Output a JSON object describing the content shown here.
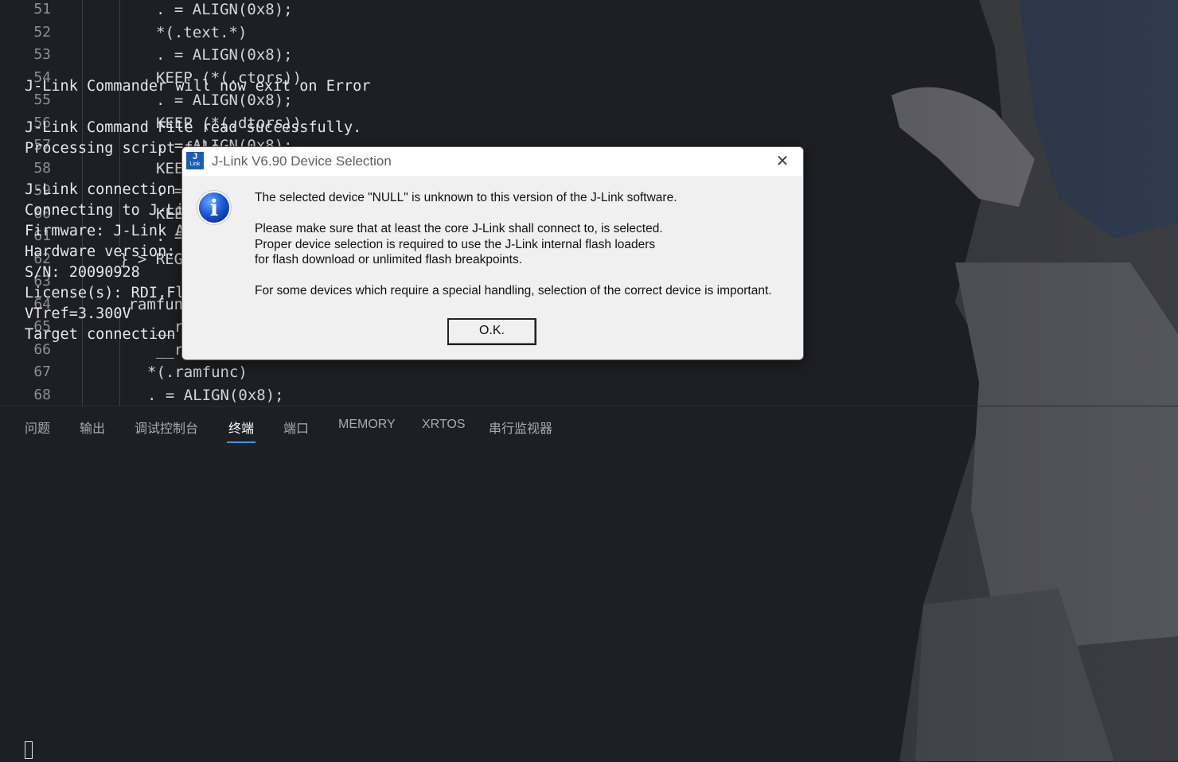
{
  "editor": {
    "lines": [
      {
        "num": "51",
        "text": ". = ALIGN(0x8);"
      },
      {
        "num": "52",
        "text": "*(.text.*)"
      },
      {
        "num": "53",
        "text": ". = ALIGN(0x8);"
      },
      {
        "num": "54",
        "text": "KEEP (*(.ctors))"
      },
      {
        "num": "55",
        "text": ". = ALIGN(0x8);"
      },
      {
        "num": "56",
        "text": "KEEP (*(.dtors))"
      },
      {
        "num": "57",
        "text": ". = ALIGN(0x8);"
      },
      {
        "num": "58",
        "text": "KEE"
      },
      {
        "num": "59",
        "text": ". ="
      },
      {
        "num": "60",
        "text": "KEE"
      },
      {
        "num": "61",
        "text": ". ="
      },
      {
        "num": "62",
        "text": "} > REG"
      },
      {
        "num": "63",
        "text": ""
      },
      {
        "num": "64",
        "text": ".ramfun"
      },
      {
        "num": "65",
        "text": "__r"
      },
      {
        "num": "66",
        "text": "__r"
      },
      {
        "num": "67",
        "text": "*(.ramfunc)"
      },
      {
        "num": "68",
        "text": ". = ALIGN(0x8);"
      }
    ]
  },
  "panel": {
    "tabs": [
      {
        "label": "问题"
      },
      {
        "label": "输出"
      },
      {
        "label": "调试控制台"
      },
      {
        "label": "终端"
      },
      {
        "label": "端口"
      },
      {
        "label": "MEMORY"
      },
      {
        "label": "XRTOS"
      },
      {
        "label": "串行监视器"
      }
    ],
    "active_tab": "终端",
    "terminal_lines": [
      "J-Link Commander will now exit on Error",
      "",
      "J-Link Command File read successfully.",
      "Processing script file...",
      "",
      "J-Link connection not established yet but required for command.",
      "Connecting to J-Link via USB...O.K.",
      "Firmware: J-Link ARM-OB STM32 compiled Aug 22 2012 19:52:04",
      "Hardware version: V7.00",
      "S/N: 20090928",
      "License(s): RDI,FlashDL,FlashBP,JFlash,GDB",
      "VTref=3.300V",
      "Target connection not established yet but required for command."
    ]
  },
  "dialog": {
    "app_icon_text": "J",
    "app_icon_subtext": "Link",
    "title": "J-Link V6.90 Device Selection",
    "close_glyph": "✕",
    "message_1": "The selected device \"NULL\" is unknown to this version of the J-Link software.",
    "message_2": "Please make sure that at least the core J-Link shall connect to, is selected.",
    "message_3": "Proper device selection is required to use the J-Link internal flash loaders",
    "message_4": "for flash download or unlimited flash breakpoints.",
    "message_5": "For some devices which require a special handling, selection of the correct device is important.",
    "ok_label": "O.K.",
    "info_icon_glyph": "i"
  },
  "colors": {
    "editor_background": "#1e1f22",
    "active_tab_underline": "#3794ff",
    "dialog_background": "#f0f0f0"
  }
}
